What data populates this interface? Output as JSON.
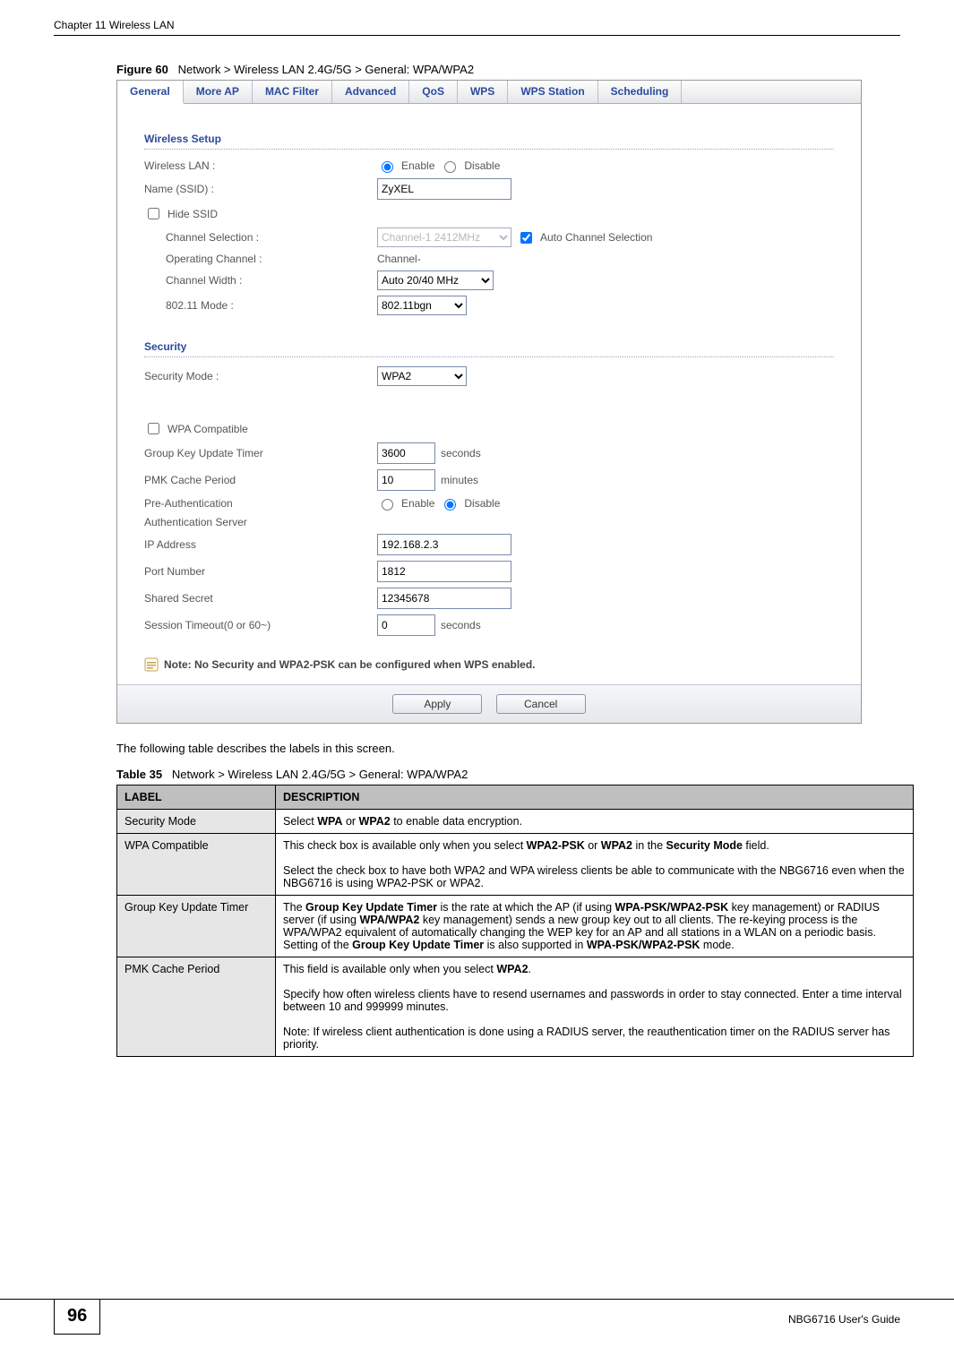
{
  "header": {
    "chapter": "Chapter 11 Wireless LAN"
  },
  "figure": {
    "prefix": "Figure 60",
    "title": "Network > Wireless LAN 2.4G/5G > General: WPA/WPA2"
  },
  "tabs": [
    "General",
    "More AP",
    "MAC Filter",
    "Advanced",
    "QoS",
    "WPS",
    "WPS Station",
    "Scheduling"
  ],
  "sections": {
    "wireless": "Wireless Setup",
    "security": "Security"
  },
  "fields": {
    "wlan_label": "Wireless LAN :",
    "enable": "Enable",
    "disable": "Disable",
    "ssid_label": "Name (SSID) :",
    "ssid_value": "ZyXEL",
    "hide_ssid": "Hide SSID",
    "channel_sel_label": "Channel Selection :",
    "channel_sel_value": "Channel-1 2412MHz",
    "auto_channel": "Auto Channel Selection",
    "op_channel_label": "Operating Channel :",
    "op_channel_value": "Channel-",
    "chan_width_label": "Channel Width :",
    "chan_width_value": "Auto 20/40 MHz",
    "mode_label": "802.11 Mode :",
    "mode_value": "802.11bgn",
    "secmode_label": "Security Mode :",
    "secmode_value": "WPA2",
    "wpa_compat": "WPA Compatible",
    "gkut_label": "Group Key Update Timer",
    "gkut_value": "3600",
    "seconds": "seconds",
    "pmk_label": "PMK Cache Period",
    "pmk_value": "10",
    "minutes": "minutes",
    "preauth_label": "Pre-Authentication",
    "authsrv_label": "Authentication Server",
    "ip_label": "IP Address",
    "ip_value": "192.168.2.3",
    "port_label": "Port Number",
    "port_value": "1812",
    "secret_label": "Shared Secret",
    "secret_value": "12345678",
    "timeout_label": "Session Timeout(0 or 60~)",
    "timeout_value": "0"
  },
  "note": "Note: No Security and WPA2-PSK can be configured when WPS enabled.",
  "buttons": {
    "apply": "Apply",
    "cancel": "Cancel"
  },
  "body_text": "The following table describes the labels in this screen.",
  "table": {
    "prefix": "Table 35",
    "title": "Network > Wireless LAN 2.4G/5G > General: WPA/WPA2",
    "head_label": "LABEL",
    "head_desc": "DESCRIPTION",
    "rows": [
      {
        "label": "Security Mode",
        "desc": "Select <b>WPA</b> or <b>WPA2</b> to enable data encryption."
      },
      {
        "label": "WPA Compatible",
        "desc": "This check box is available only when you select <b>WPA2-PSK</b> or <b>WPA2</b> in the <b>Security Mode</b> field.<br><br>Select the check box to have both WPA2 and WPA wireless clients be able to communicate with the NBG6716 even when the NBG6716 is using WPA2-PSK or WPA2."
      },
      {
        "label": "Group Key Update Timer",
        "desc": "The <b>Group Key Update Timer</b> is the rate at which the AP (if using <b>WPA-PSK/WPA2-PSK</b> key management) or RADIUS server (if using <b>WPA/WPA2</b> key management) sends a new group key out to all clients. The re-keying process is the WPA/WPA2 equivalent of automatically changing the WEP key for an AP and all stations in a WLAN on a periodic basis. Setting of the <b>Group Key Update Timer</b> is also supported in <b>WPA-PSK/WPA2-PSK</b> mode."
      },
      {
        "label": "PMK Cache Period",
        "desc": "This field is available only when you select <b>WPA2</b>.<br><br>Specify how often wireless clients have to resend usernames and passwords in order to stay connected. Enter a time interval between 10 and 999999 minutes.<br><br>Note: If wireless client authentication is done using a RADIUS server, the reauthentication timer on the RADIUS server has priority."
      }
    ]
  },
  "footer": {
    "page": "96",
    "guide": "NBG6716 User's Guide"
  }
}
